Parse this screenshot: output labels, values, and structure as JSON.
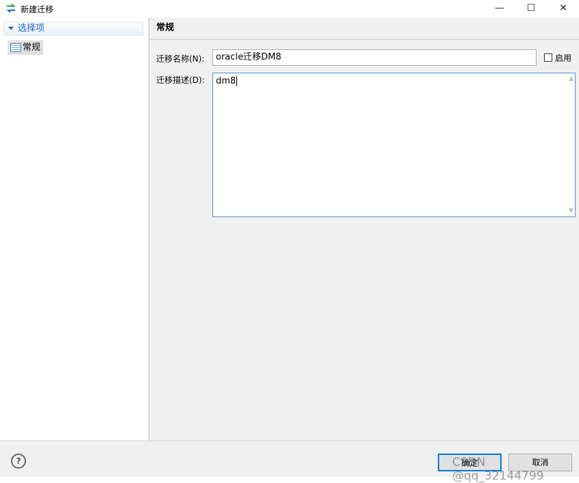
{
  "window": {
    "title": "新建迁移",
    "minimize": "—",
    "maximize": "☐",
    "close": "✕"
  },
  "sidebar": {
    "section": "选择项",
    "items": [
      {
        "label": "常规"
      }
    ]
  },
  "main": {
    "header": "常规",
    "name_label": "迁移名称(N):",
    "name_value": "oracle迁移DM8",
    "enable_label": "启用",
    "enabled": false,
    "desc_label": "迁移描述(D):",
    "desc_value": "dm8"
  },
  "footer": {
    "help": "?",
    "ok": "确定",
    "cancel": "取消"
  },
  "watermark": "CSDN @qq_32144799"
}
